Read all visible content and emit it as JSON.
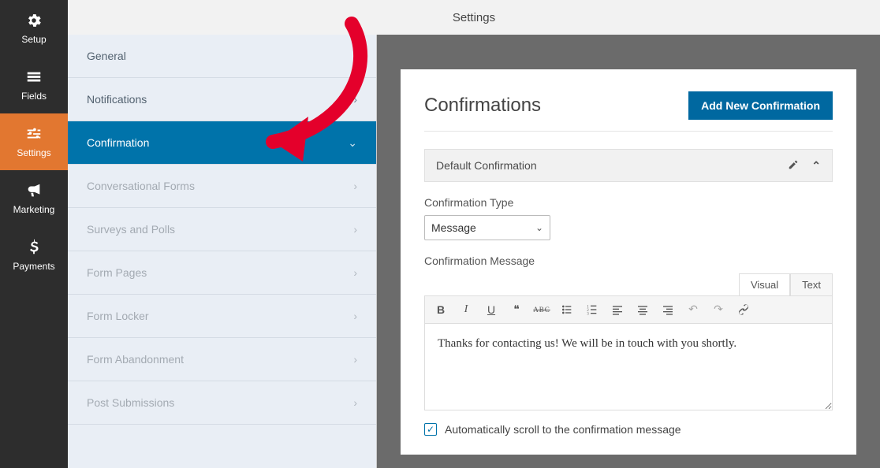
{
  "header": {
    "title": "Settings"
  },
  "rail": {
    "items": [
      {
        "id": "setup",
        "label": "Setup",
        "active": false
      },
      {
        "id": "fields",
        "label": "Fields",
        "active": false
      },
      {
        "id": "settings",
        "label": "Settings",
        "active": true
      },
      {
        "id": "marketing",
        "label": "Marketing",
        "active": false
      },
      {
        "id": "payments",
        "label": "Payments",
        "active": false
      }
    ]
  },
  "sidebar": {
    "items": [
      {
        "label": "General",
        "active": false,
        "dim": false,
        "caret": "right"
      },
      {
        "label": "Notifications",
        "active": false,
        "dim": false,
        "caret": "right"
      },
      {
        "label": "Confirmation",
        "active": true,
        "dim": false,
        "caret": "down"
      },
      {
        "label": "Conversational Forms",
        "active": false,
        "dim": true,
        "caret": "right"
      },
      {
        "label": "Surveys and Polls",
        "active": false,
        "dim": true,
        "caret": "right"
      },
      {
        "label": "Form Pages",
        "active": false,
        "dim": true,
        "caret": "right"
      },
      {
        "label": "Form Locker",
        "active": false,
        "dim": true,
        "caret": "right"
      },
      {
        "label": "Form Abandonment",
        "active": false,
        "dim": true,
        "caret": "right"
      },
      {
        "label": "Post Submissions",
        "active": false,
        "dim": true,
        "caret": "right"
      }
    ]
  },
  "panel": {
    "title": "Confirmations",
    "add_button": "Add New Confirmation",
    "card_title": "Default Confirmation",
    "type_label": "Confirmation Type",
    "type_value": "Message",
    "message_label": "Confirmation Message",
    "tabs": {
      "visual": "Visual",
      "text": "Text",
      "active": "visual"
    },
    "toolbar_icons": {
      "bold": "B",
      "italic": "I",
      "underline": "U",
      "quote": "❝",
      "strike": "ABC"
    },
    "message_body": "Thanks for contacting us! We will be in touch with you shortly.",
    "checkbox_label": "Automatically scroll to the confirmation message",
    "checkbox_checked": true
  },
  "annotation": {
    "name": "red-arrow-pointing-to-confirmation"
  },
  "colors": {
    "accent": "#0073aa",
    "rail_active": "#e27730"
  }
}
